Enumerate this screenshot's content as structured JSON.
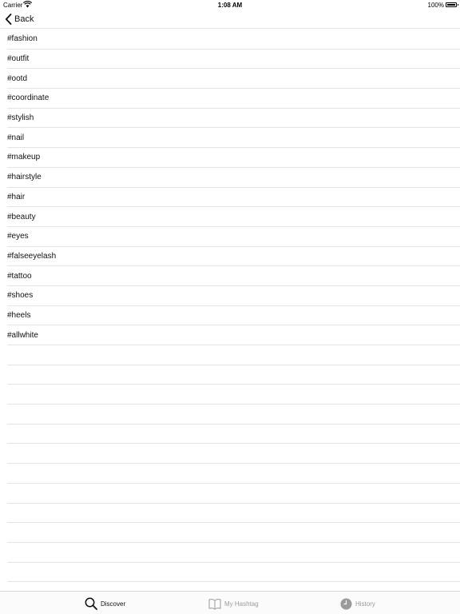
{
  "status_bar": {
    "carrier": "Carrier",
    "time": "1:08 AM",
    "battery": "100%"
  },
  "nav": {
    "back_label": "Back"
  },
  "hashtags": [
    "#fashion",
    "#outfit",
    "#ootd",
    "#coordinate",
    "#stylish",
    "#nail",
    "#makeup",
    "#hairstyle",
    "#hair",
    "#beauty",
    "#eyes",
    "#falseeyelash",
    "#tattoo",
    "#shoes",
    "#heels",
    "#allwhite"
  ],
  "tabs": [
    {
      "label": "Discover",
      "icon": "search-icon",
      "selected": true
    },
    {
      "label": "My Hashtag",
      "icon": "book-icon",
      "selected": false
    },
    {
      "label": "History",
      "icon": "clock-icon",
      "selected": false
    }
  ],
  "colors": {
    "selected_tab": "#111111",
    "unselected_tab": "#9a9a9a",
    "separator": "#e4e4e4"
  }
}
